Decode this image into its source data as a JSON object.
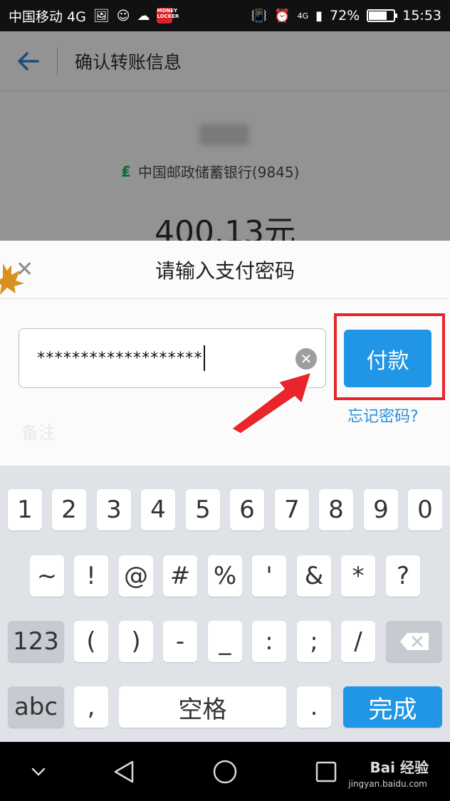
{
  "status_bar": {
    "carrier": "中国移动 4G",
    "money_locker": "MONEY LOCKER",
    "network": "4G",
    "battery": "72%",
    "battery_level": 0.72,
    "time": "15:53"
  },
  "page": {
    "title": "确认转账信息",
    "bank": "中国邮政储蓄银行(9845)",
    "amount": "400.13元"
  },
  "dialog": {
    "title": "请输入支付密码",
    "password_mask": "*******************",
    "pay_label": "付款",
    "forgot_label": "忘记密码?",
    "remark_label": "备注"
  },
  "keyboard": {
    "row1": [
      "1",
      "2",
      "3",
      "4",
      "5",
      "6",
      "7",
      "8",
      "9",
      "0"
    ],
    "row2": [
      "~",
      "!",
      "@",
      "#",
      "%",
      "'",
      "&",
      "*",
      "?"
    ],
    "row3": [
      "123",
      "(",
      ")",
      "-",
      "_",
      ":",
      ";",
      "/"
    ],
    "row4": {
      "abc": "abc",
      "comma": ",",
      "space": "空格",
      "period": ".",
      "done": "完成"
    }
  },
  "nav_bar": {
    "watermark": "Bai 经验",
    "watermark_url": "jingyan.baidu.com"
  },
  "colors": {
    "accent": "#2196e6",
    "highlight": "#e8252b",
    "link": "#2a8fd8"
  }
}
